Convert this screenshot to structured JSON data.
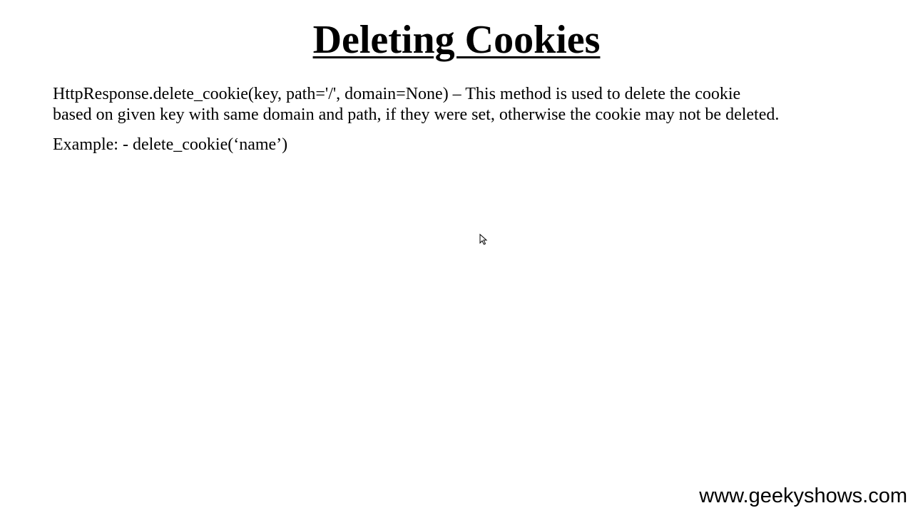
{
  "slide": {
    "title": "Deleting Cookies",
    "description_lines": [
      "HttpResponse.delete_cookie(key, path='/', domain=None) – This method is used to delete the cookie",
      "based on given key with same domain and path, if they were set, otherwise the cookie may not be deleted."
    ],
    "example": "Example: - delete_cookie(‘name’)",
    "watermark": "www.geekyshows.com"
  }
}
